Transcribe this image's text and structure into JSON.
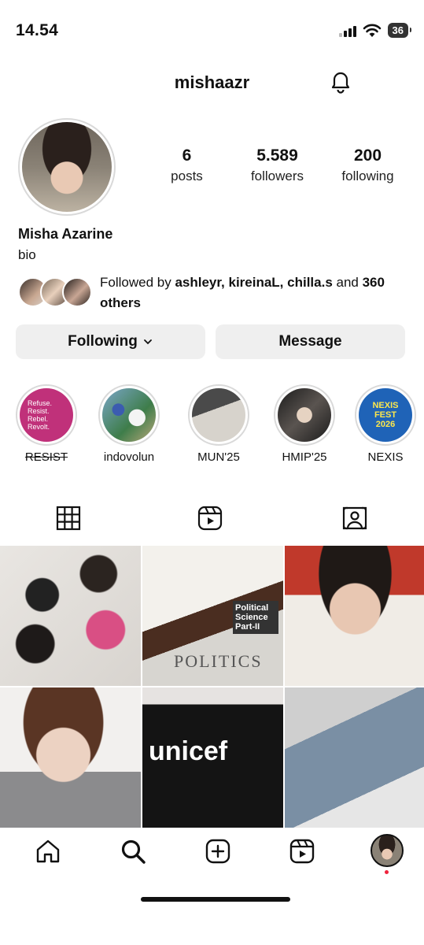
{
  "status_bar": {
    "time": "14.54",
    "battery": "36",
    "icons": [
      "signal-icon",
      "wifi-icon",
      "battery-icon"
    ]
  },
  "header": {
    "username": "mishaazr",
    "notification_icon": "bell-icon"
  },
  "profile": {
    "name": "Misha Azarine",
    "bio": "bio",
    "stats": [
      {
        "value": "6",
        "label": "posts"
      },
      {
        "value": "5.589",
        "label": "followers"
      },
      {
        "value": "200",
        "label": "following"
      }
    ],
    "followed_by": {
      "prefix": "Followed by ",
      "names": "ashleyr, kireinaL, chilla.s",
      "middle": " and ",
      "others": "360 others"
    }
  },
  "actions": {
    "following_label": "Following",
    "message_label": "Message"
  },
  "highlights": [
    {
      "label": "RESIST",
      "strikethrough": true,
      "thumb_text": "Refuse. Resist. Rebel. Revolt."
    },
    {
      "label": "indovolun"
    },
    {
      "label": "MUN'25"
    },
    {
      "label": "HMIP'25"
    },
    {
      "label": "NEXIS",
      "thumb_text": "NEXIS FEST 2026"
    }
  ],
  "tabs": [
    "grid-icon",
    "reels-icon",
    "tagged-icon"
  ],
  "grid_posts": [
    {
      "description": "children drawing"
    },
    {
      "description": "politics books",
      "text_1": "POLITICS",
      "text_2": "Political Science Part-II"
    },
    {
      "description": "portrait"
    },
    {
      "description": "portrait"
    },
    {
      "description": "unicef shirt",
      "text": "unicef"
    },
    {
      "description": "laptop desk"
    }
  ],
  "bottom_nav": [
    "home-icon",
    "search-icon",
    "create-icon",
    "reels-icon",
    "profile-avatar"
  ]
}
